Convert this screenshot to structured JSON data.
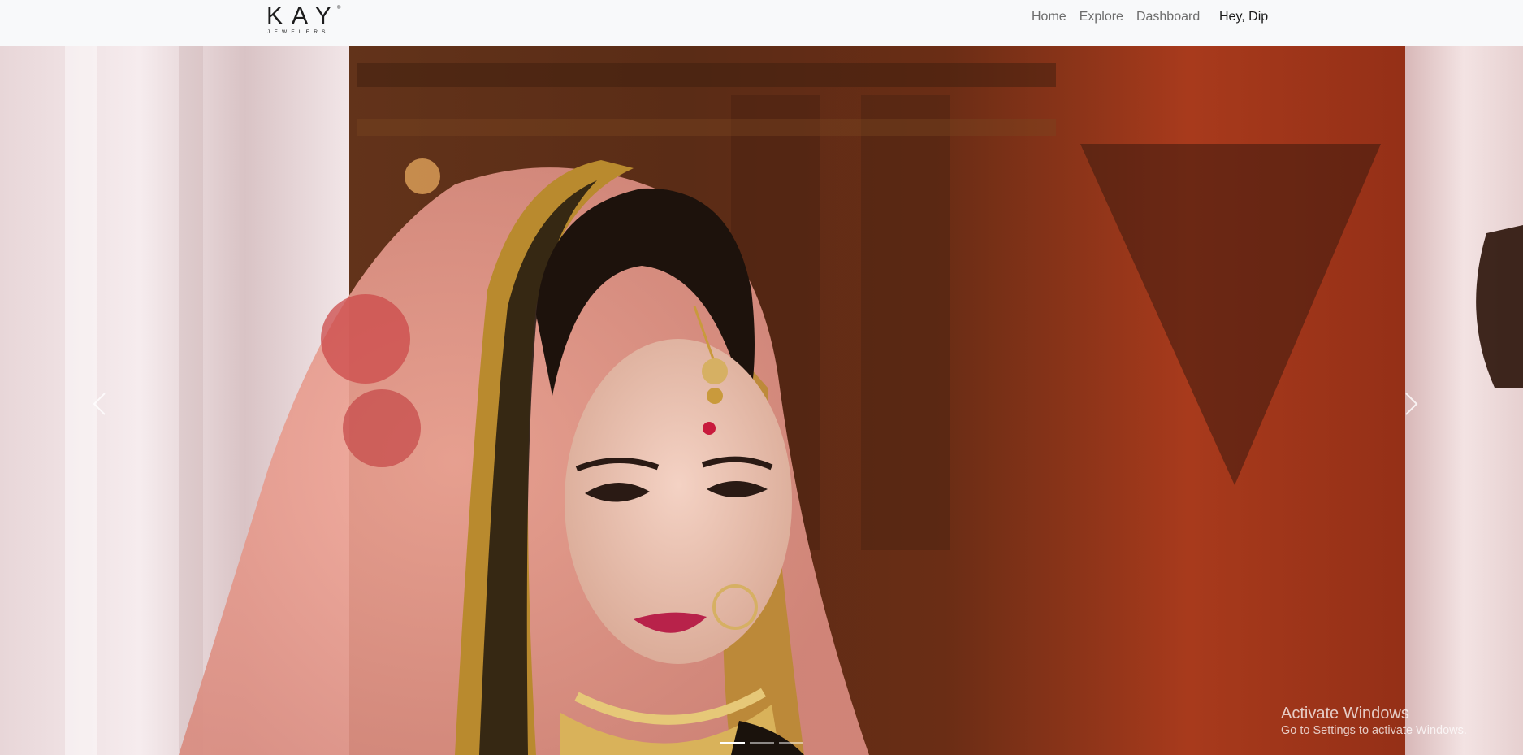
{
  "brand": {
    "name": "KAY",
    "sub": "JEWELERS",
    "reg": "®"
  },
  "nav": {
    "links": [
      "Home",
      "Explore",
      "Dashboard"
    ],
    "user_greeting": "Hey, Dip"
  },
  "carousel": {
    "slide_count": 3,
    "active_index": 0,
    "slide_image": "bride-in-pink-dupatta-with-gold-jewelry"
  },
  "watermark": {
    "title": "Activate Windows",
    "subtitle": "Go to Settings to activate Windows."
  },
  "colors": {
    "navbar_bg": "#f8f9fa",
    "link": "#6c6c6c",
    "user": "#1a1a1a"
  }
}
